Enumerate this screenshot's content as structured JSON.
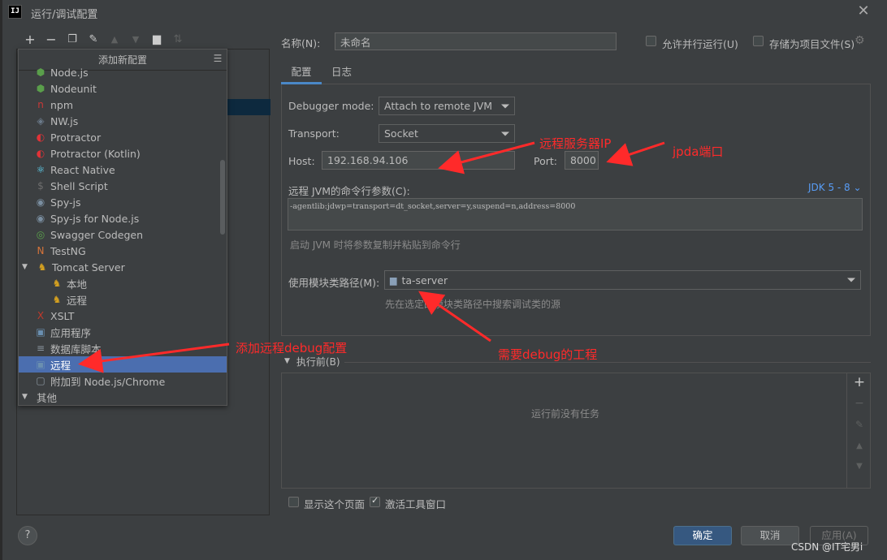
{
  "window": {
    "title": "运行/调试配置",
    "app_icon_label": "IJ",
    "close_glyph": "✕"
  },
  "toolbar": {
    "icons": [
      "add-icon",
      "remove-icon",
      "copy-icon",
      "wrench-icon",
      "move-up-icon",
      "move-down-icon",
      "folder-add-icon",
      "sort-icon"
    ]
  },
  "popup": {
    "header": "添加新配置",
    "items": [
      {
        "label": "Node.js",
        "icon": "nodejs-icon",
        "color": "#5a9e4b"
      },
      {
        "label": "Nodeunit",
        "icon": "nodeunit-icon",
        "color": "#5a9e4b"
      },
      {
        "label": "npm",
        "icon": "npm-icon",
        "color": "#cb3837"
      },
      {
        "label": "NW.js",
        "icon": "nwjs-icon",
        "color": "#6b7a8a"
      },
      {
        "label": "Protractor",
        "icon": "protractor-icon",
        "color": "#e23237"
      },
      {
        "label": "Protractor (Kotlin)",
        "icon": "protractor-icon",
        "color": "#e23237"
      },
      {
        "label": "React Native",
        "icon": "react-icon",
        "color": "#61dafb"
      },
      {
        "label": "Shell Script",
        "icon": "shell-icon",
        "color": "#6d6d6d"
      },
      {
        "label": "Spy-js",
        "icon": "spyjs-icon",
        "color": "#7a8ea0"
      },
      {
        "label": "Spy-js for Node.js",
        "icon": "spyjs-icon",
        "color": "#7a8ea0"
      },
      {
        "label": "Swagger Codegen",
        "icon": "swagger-icon",
        "color": "#5aa04b"
      },
      {
        "label": "TestNG",
        "icon": "testng-icon",
        "color": "#d7743a"
      },
      {
        "label": "Tomcat Server",
        "icon": "tomcat-icon",
        "color": "#d4a020",
        "expanded": true
      },
      {
        "label": "本地",
        "icon": "tomcat-icon",
        "color": "#d4a020",
        "child": true
      },
      {
        "label": "远程",
        "icon": "tomcat-icon",
        "color": "#d4a020",
        "child": true
      },
      {
        "label": "XSLT",
        "icon": "xslt-icon",
        "color": "#c0392b"
      },
      {
        "label": "应用程序",
        "icon": "application-icon",
        "color": "#6a8fb0"
      },
      {
        "label": "数据库脚本",
        "icon": "database-icon",
        "color": "#8b96a0"
      },
      {
        "label": "远程",
        "icon": "remote-icon",
        "color": "#6a8fb0",
        "selected": true
      },
      {
        "label": "附加到 Node.js/Chrome",
        "icon": "attach-icon",
        "color": "#8b96a0"
      },
      {
        "label": "其他",
        "icon": "",
        "color": "",
        "group": true
      }
    ]
  },
  "form": {
    "name_label": "名称(N):",
    "name_value": "未命名",
    "allow_parallel_label": "允许并行运行(U)",
    "store_project_label": "存储为项目文件(S)",
    "tabs": [
      "配置",
      "日志"
    ],
    "debugger_mode_label": "Debugger mode:",
    "debugger_mode_value": "Attach to remote JVM",
    "transport_label": "Transport:",
    "transport_value": "Socket",
    "host_label": "Host:",
    "host_value": "192.168.94.106",
    "port_label": "Port:",
    "port_value": "8000",
    "cmdline_label": "远程 JVM的命令行参数(C):",
    "jdk_link": "JDK 5 - 8",
    "cmdline_value": "-agentlib:jdwp=transport=dt_socket,server=y,suspend=n,address=8000",
    "cmdline_hint": "启动 JVM 时将参数复制并粘贴到命令行",
    "module_label": "使用模块类路径(M):",
    "module_value": "ta-server",
    "module_hint": "先在选定的模块类路径中搜索调试类的源",
    "before_launch": "执行前(B)",
    "no_tasks": "运行前没有任务",
    "show_page_label": "显示这个页面",
    "activate_tool_label": "激活工具窗口"
  },
  "buttons": {
    "ok": "确定",
    "cancel": "取消",
    "apply": "应用(A)",
    "help": "?"
  },
  "annotations": {
    "remote_ip": "远程服务器IP",
    "jpda_port": "jpda端口",
    "add_remote": "添加远程debug配置",
    "need_debug": "需要debug的工程",
    "color": "#ff2a2a"
  },
  "watermark": "CSDN @IT宅男i",
  "side_buttons": {
    "add": "+",
    "remove": "−"
  }
}
